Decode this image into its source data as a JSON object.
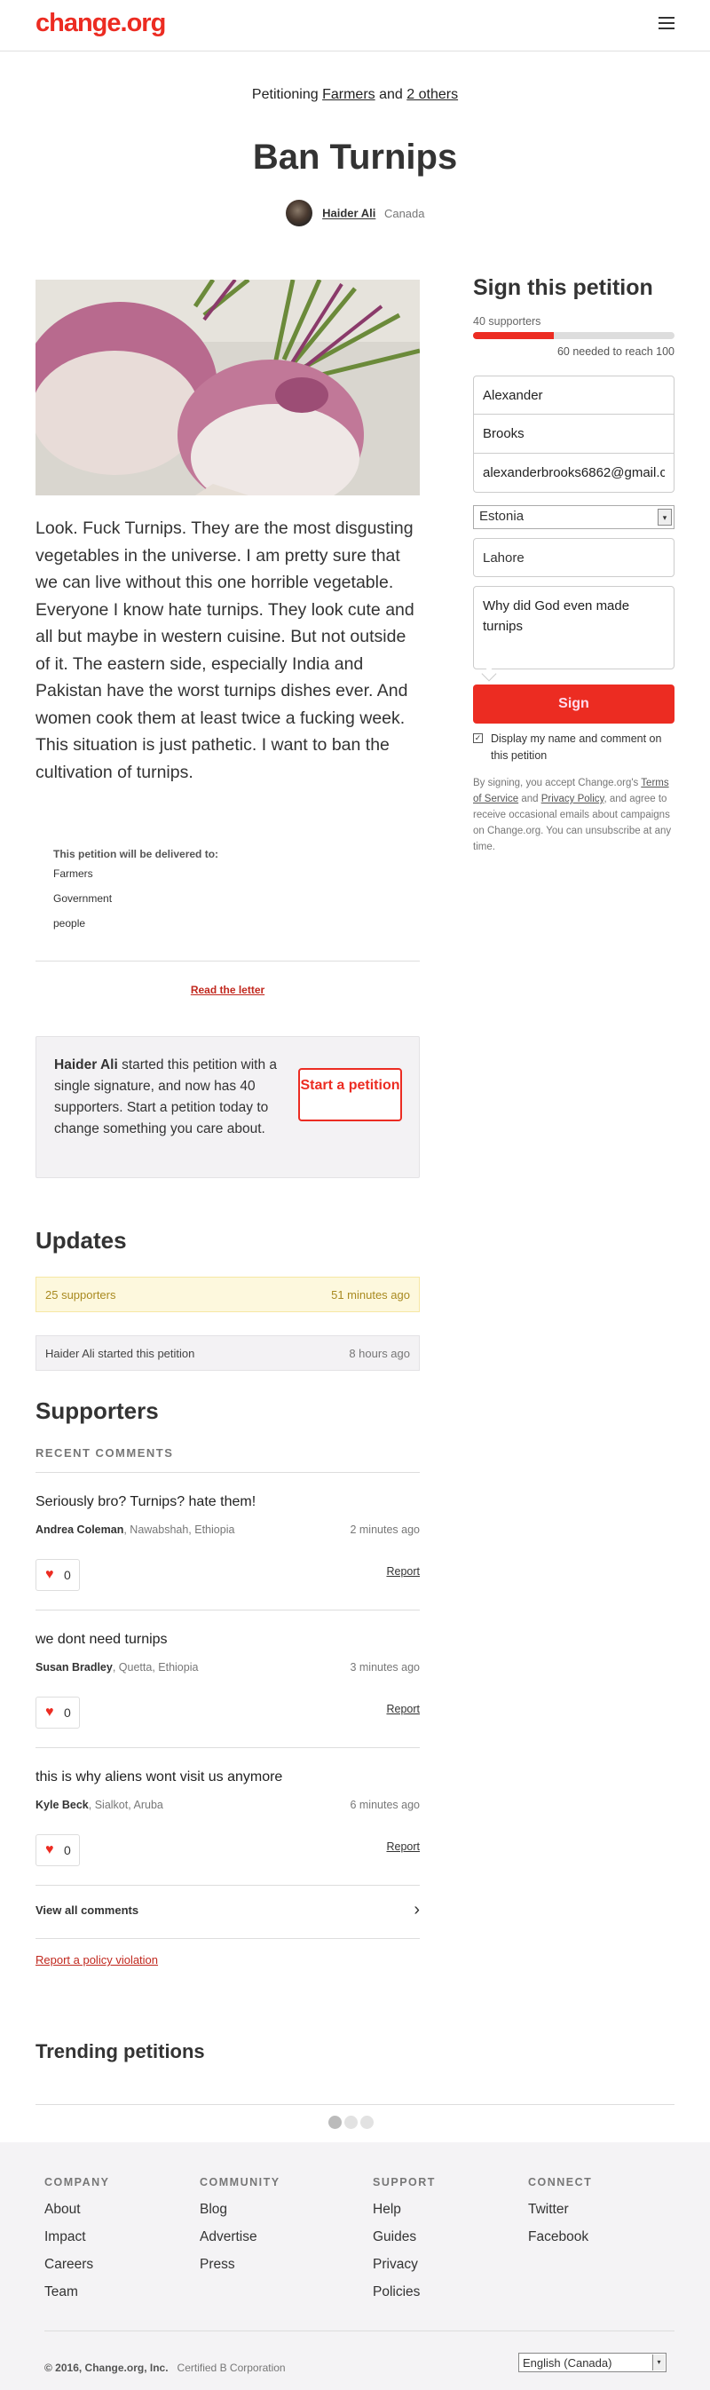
{
  "header": {
    "logo": "change.org",
    "menu_icon": "hamburger-menu-icon"
  },
  "petition": {
    "petitioning_prefix": "Petitioning",
    "target_1": "Farmers",
    "and_word": "and",
    "target_others": "2 others",
    "title": "Ban Turnips",
    "author_name": "Haider Ali",
    "author_country": "Canada",
    "body": "Look. Fuck Turnips. They are the most disgusting vegetables in the universe. I am pretty sure that we can live without this one horrible vegetable. Everyone I know hate turnips. They look cute and all but maybe in western cuisine. But not outside of it. The eastern side, especially India and Pakistan have the worst turnips dishes ever. And women cook them at least twice a fucking week. This situation is just pathetic. I want to ban the cultivation of turnips.",
    "delivered_label": "This petition will be delivered to:",
    "delivered_to": [
      "Farmers",
      "Government",
      "people"
    ],
    "read_letter": "Read the letter"
  },
  "starter": {
    "name": "Haider Ali",
    "text": " started this petition with a single signature, and now has 40 supporters. Start a petition today to change something you care about.",
    "button": "Start a petition"
  },
  "updates": {
    "heading": "Updates",
    "items": [
      {
        "text": "25 supporters",
        "time": "51 minutes ago"
      },
      {
        "text": "Haider Ali started this petition",
        "time": "8 hours ago"
      }
    ]
  },
  "supporters": {
    "heading": "Supporters",
    "recent_label": "RECENT COMMENTS",
    "comments": [
      {
        "quote": "Seriously bro? Turnips? hate them!",
        "name": "Andrea Coleman",
        "location": ", Nawabshah, Ethiopia",
        "time": "2 minutes ago",
        "likes": "0",
        "report": "Report"
      },
      {
        "quote": "we dont need turnips",
        "name": "Susan Bradley",
        "location": ", Quetta, Ethiopia",
        "time": "3 minutes ago",
        "likes": "0",
        "report": "Report"
      },
      {
        "quote": "this is why aliens wont visit us anymore",
        "name": "Kyle Beck",
        "location": ", Sialkot, Aruba",
        "time": "6 minutes ago",
        "likes": "0",
        "report": "Report"
      }
    ],
    "view_all": "View all comments",
    "policy": "Report a policy violation"
  },
  "trending": {
    "heading": "Trending petitions"
  },
  "sign": {
    "title": "Sign this petition",
    "supporters": "40 supporters",
    "progress_fraction": 0.4,
    "needed": "60 needed to reach 100",
    "first_name": "Alexander",
    "last_name": "Brooks",
    "email": "alexanderbrooks6862@gmail.com",
    "country": "Estonia",
    "city": "Lahore",
    "reason": "Why did God even made turnips",
    "button": "Sign",
    "display_label": "Display my name and comment on this petition",
    "legal_1": "By signing, you accept Change.org's ",
    "terms": "Terms of Service",
    "and": " and ",
    "privacy": "Privacy Policy",
    "legal_2": ", and agree to receive occasional emails about campaigns on Change.org. You can unsubscribe at any time."
  },
  "footer": {
    "columns": [
      {
        "heading": "COMPANY",
        "links": [
          "About",
          "Impact",
          "Careers",
          "Team"
        ]
      },
      {
        "heading": "COMMUNITY",
        "links": [
          "Blog",
          "Advertise",
          "Press"
        ]
      },
      {
        "heading": "SUPPORT",
        "links": [
          "Help",
          "Guides",
          "Privacy",
          "Policies"
        ]
      },
      {
        "heading": "CONNECT",
        "links": [
          "Twitter",
          "Facebook"
        ]
      }
    ],
    "copyright": "© 2016, Change.org, Inc.",
    "bcorp": "Certified B Corporation",
    "language": "English (Canada)"
  },
  "colors": {
    "brand_red": "#ec2c22",
    "link_red": "#c1281e"
  }
}
